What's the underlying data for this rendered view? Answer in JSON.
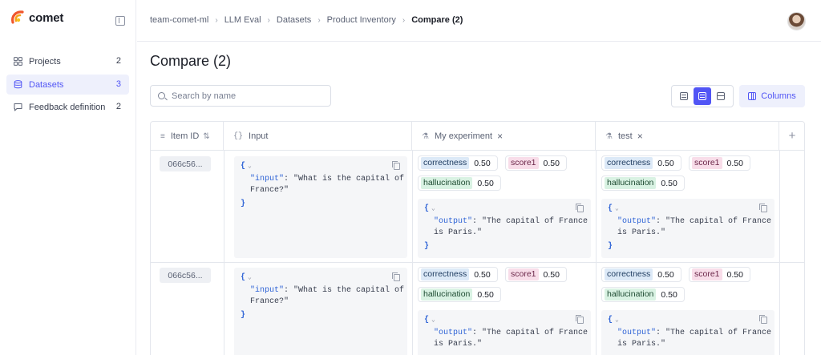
{
  "brand": {
    "name": "comet"
  },
  "sidebar": {
    "items": [
      {
        "label": "Projects",
        "count": "2"
      },
      {
        "label": "Datasets",
        "count": "3"
      },
      {
        "label": "Feedback definition",
        "count": "2"
      }
    ]
  },
  "breadcrumb": [
    "team-comet-ml",
    "LLM Eval",
    "Datasets",
    "Product Inventory",
    "Compare (2)"
  ],
  "page": {
    "title": "Compare (2)"
  },
  "search": {
    "placeholder": "Search by name"
  },
  "toolbar": {
    "columns_label": "Columns"
  },
  "table": {
    "headers": {
      "item_id": "Item ID",
      "input": "Input",
      "exp1": "My experiment",
      "exp2": "test"
    },
    "rows": [
      {
        "id": "066c56...",
        "input": {
          "key": "\"input\"",
          "value_line1": ": \"What is the capital of",
          "value_line2": "France?\""
        },
        "exp1": {
          "scores": [
            {
              "name": "correctness",
              "value": "0.50",
              "color": "blue"
            },
            {
              "name": "score1",
              "value": "0.50",
              "color": "pink"
            },
            {
              "name": "hallucination",
              "value": "0.50",
              "color": "green"
            }
          ],
          "output": {
            "key": "\"output\"",
            "value_line1": ": \"The capital of France",
            "value_line2": "is Paris.\""
          }
        },
        "exp2": {
          "scores": [
            {
              "name": "correctness",
              "value": "0.50",
              "color": "blue"
            },
            {
              "name": "score1",
              "value": "0.50",
              "color": "pink"
            },
            {
              "name": "hallucination",
              "value": "0.50",
              "color": "green"
            }
          ],
          "output": {
            "key": "\"output\"",
            "value_line1": ": \"The capital of France",
            "value_line2": "is Paris.\""
          }
        }
      },
      {
        "id": "066c56...",
        "input": {
          "key": "\"input\"",
          "value_line1": ": \"What is the capital of",
          "value_line2": "France?\""
        },
        "exp1": {
          "scores": [
            {
              "name": "correctness",
              "value": "0.50",
              "color": "blue"
            },
            {
              "name": "score1",
              "value": "0.50",
              "color": "pink"
            },
            {
              "name": "hallucination",
              "value": "0.50",
              "color": "green"
            }
          ],
          "output": {
            "key": "\"output\"",
            "value_line1": ": \"The capital of France",
            "value_line2": "is Paris.\""
          }
        },
        "exp2": {
          "scores": [
            {
              "name": "correctness",
              "value": "0.50",
              "color": "blue"
            },
            {
              "name": "score1",
              "value": "0.50",
              "color": "pink"
            },
            {
              "name": "hallucination",
              "value": "0.50",
              "color": "green"
            }
          ],
          "output": {
            "key": "\"output\"",
            "value_line1": ": \"The capital of France",
            "value_line2": "is Paris.\""
          }
        }
      }
    ]
  },
  "colors": {
    "accent": "#5155f5",
    "active_bg": "#eef0fc"
  }
}
